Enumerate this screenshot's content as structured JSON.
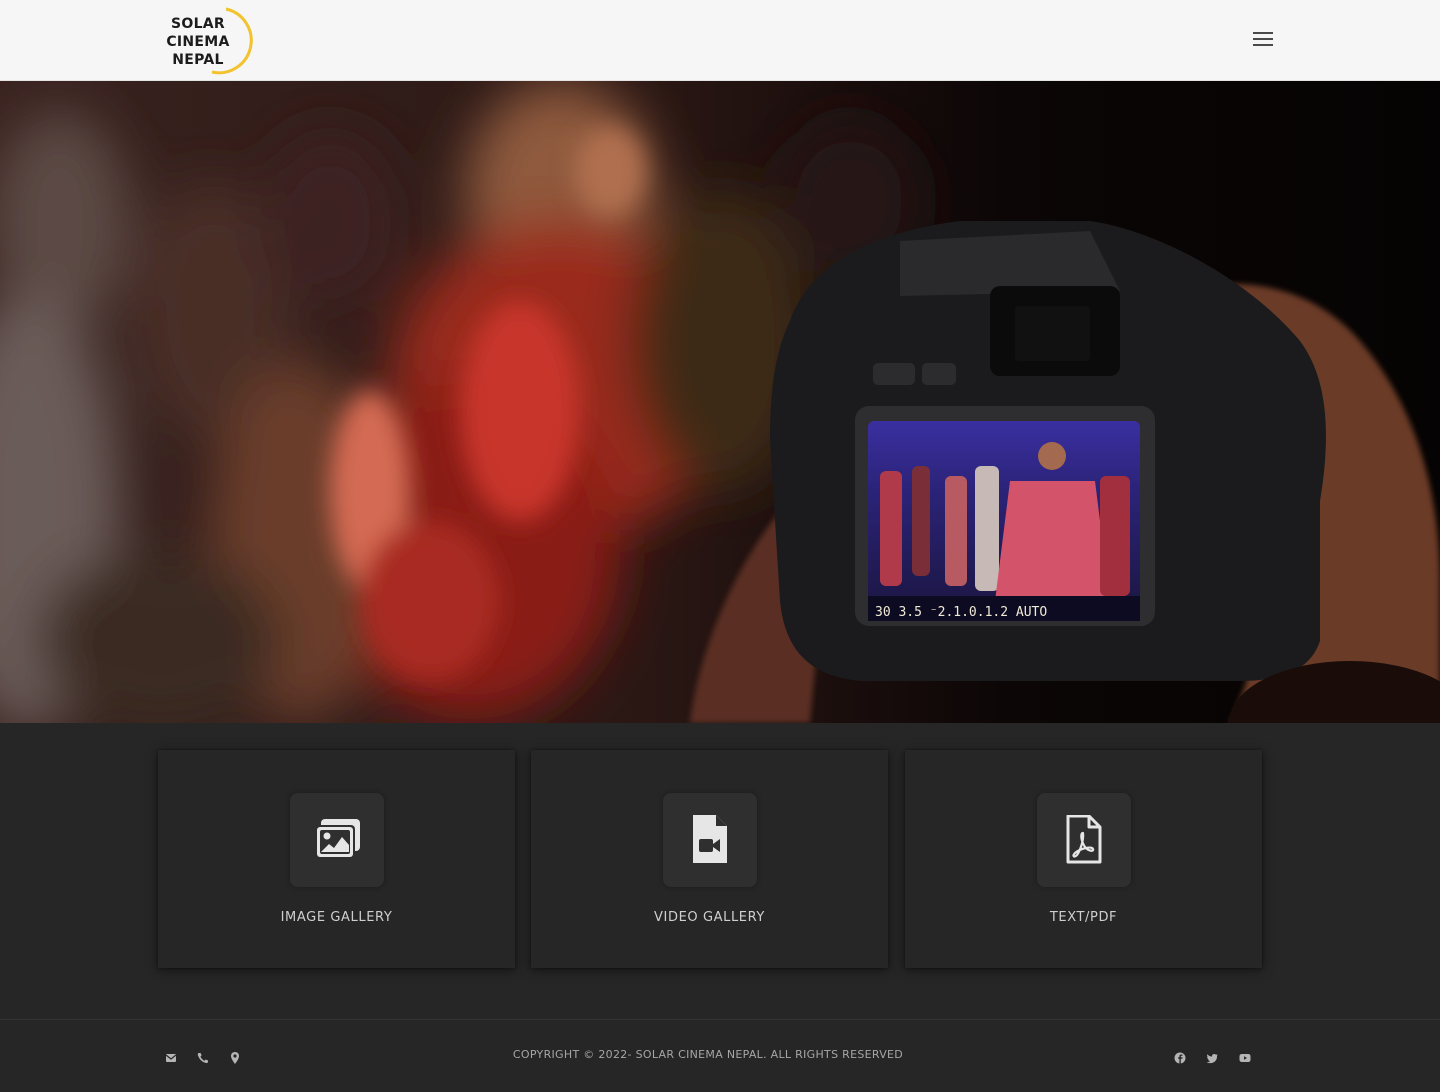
{
  "header": {
    "logo_lines": [
      "SOLAR",
      "CINEMA",
      "NEPAL"
    ],
    "menu_icon": "hamburger-menu-icon"
  },
  "hero": {
    "image_icon": "hero-photo"
  },
  "cards": [
    {
      "label": "IMAGE GALLERY",
      "icon": "images-icon"
    },
    {
      "label": "VIDEO GALLERY",
      "icon": "file-video-icon"
    },
    {
      "label": "TEXT/PDF",
      "icon": "file-pdf-icon"
    }
  ],
  "footer": {
    "contact_icons": [
      "envelope-icon",
      "phone-icon",
      "map-marker-icon"
    ],
    "copyright": "COPYRIGHT © 2022- SOLAR CINEMA NEPAL. ALL RIGHTS RESERVED",
    "social_icons": [
      "facebook-icon",
      "twitter-icon",
      "youtube-icon"
    ]
  },
  "colors": {
    "brand_yellow": "#f2c32e",
    "header_bg": "#f6f6f6",
    "dark_bg": "#262626"
  }
}
